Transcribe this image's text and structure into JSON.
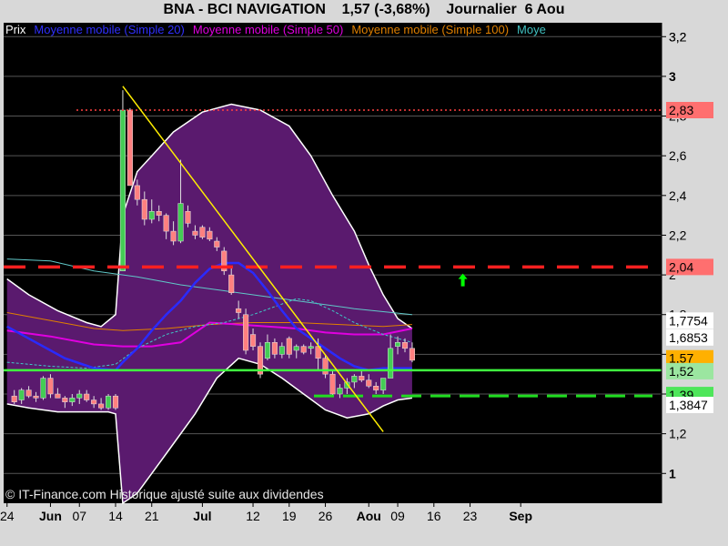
{
  "title": "BNA - BCI NAVIGATION    1,57 (-3,68%)    Journalier  6 Aou",
  "legend": [
    {
      "label": "Prix",
      "color": "#ffffff"
    },
    {
      "label": "Moyenne mobile (Simple 20)",
      "color": "#3030ff"
    },
    {
      "label": "Moyenne mobile (Simple 50)",
      "color": "#e000e0"
    },
    {
      "label": "Moyenne mobile (Simple 100)",
      "color": "#e08000"
    },
    {
      "label": "Moye",
      "color": "#40c0c0"
    }
  ],
  "copyright": "© IT-Finance.com Historique ajusté suite aux dividendes",
  "chart_data": {
    "type": "candlestick",
    "y_axis": {
      "range": [
        0.85,
        3.27
      ],
      "ticks": [
        "3,2",
        "3",
        "2,8",
        "2,6",
        "2,4",
        "2,2",
        "2",
        "1,8",
        "1,6",
        "1,4",
        "1,2",
        "1"
      ],
      "tick_values": [
        3.2,
        3.0,
        2.8,
        2.6,
        2.4,
        2.2,
        2.0,
        1.8,
        1.6,
        1.4,
        1.2,
        1.0
      ],
      "bold_ticks": [
        "3",
        "1"
      ]
    },
    "x_axis": {
      "labels": [
        {
          "text": "24",
          "i": -1,
          "bold": false
        },
        {
          "text": "Jun",
          "i": 5,
          "bold": true
        },
        {
          "text": "07",
          "i": 9,
          "bold": false
        },
        {
          "text": "14",
          "i": 14,
          "bold": false
        },
        {
          "text": "21",
          "i": 19,
          "bold": false
        },
        {
          "text": "Jul",
          "i": 26,
          "bold": true
        },
        {
          "text": "12",
          "i": 33,
          "bold": false
        },
        {
          "text": "19",
          "i": 38,
          "bold": false
        },
        {
          "text": "26",
          "i": 43,
          "bold": false
        },
        {
          "text": "Aou",
          "i": 49,
          "bold": true
        },
        {
          "text": "09",
          "i": 53,
          "bold": false
        },
        {
          "text": "16",
          "i": 58,
          "bold": false
        },
        {
          "text": "23",
          "i": 63,
          "bold": false
        },
        {
          "text": "Sep",
          "i": 70,
          "bold": true
        }
      ]
    },
    "candles": [
      {
        "o": 1.39,
        "h": 1.42,
        "l": 1.35,
        "c": 1.36
      },
      {
        "o": 1.37,
        "h": 1.43,
        "l": 1.35,
        "c": 1.42
      },
      {
        "o": 1.42,
        "h": 1.44,
        "l": 1.38,
        "c": 1.39
      },
      {
        "o": 1.39,
        "h": 1.41,
        "l": 1.36,
        "c": 1.38
      },
      {
        "o": 1.38,
        "h": 1.49,
        "l": 1.37,
        "c": 1.48
      },
      {
        "o": 1.48,
        "h": 1.5,
        "l": 1.38,
        "c": 1.4
      },
      {
        "o": 1.4,
        "h": 1.43,
        "l": 1.38,
        "c": 1.38
      },
      {
        "o": 1.38,
        "h": 1.39,
        "l": 1.33,
        "c": 1.36
      },
      {
        "o": 1.36,
        "h": 1.4,
        "l": 1.34,
        "c": 1.38
      },
      {
        "o": 1.38,
        "h": 1.42,
        "l": 1.35,
        "c": 1.4
      },
      {
        "o": 1.4,
        "h": 1.42,
        "l": 1.36,
        "c": 1.37
      },
      {
        "o": 1.37,
        "h": 1.39,
        "l": 1.33,
        "c": 1.35
      },
      {
        "o": 1.35,
        "h": 1.38,
        "l": 1.32,
        "c": 1.33
      },
      {
        "o": 1.33,
        "h": 1.4,
        "l": 1.32,
        "c": 1.39
      },
      {
        "o": 1.39,
        "h": 1.4,
        "l": 1.32,
        "c": 1.33
      },
      {
        "o": 2.02,
        "h": 2.93,
        "l": 2.02,
        "c": 2.83
      },
      {
        "o": 2.83,
        "h": 2.84,
        "l": 2.45,
        "c": 2.45
      },
      {
        "o": 2.45,
        "h": 2.48,
        "l": 2.35,
        "c": 2.38
      },
      {
        "o": 2.38,
        "h": 2.42,
        "l": 2.25,
        "c": 2.28
      },
      {
        "o": 2.28,
        "h": 2.38,
        "l": 2.26,
        "c": 2.32
      },
      {
        "o": 2.32,
        "h": 2.35,
        "l": 2.27,
        "c": 2.3
      },
      {
        "o": 2.3,
        "h": 2.31,
        "l": 2.18,
        "c": 2.22
      },
      {
        "o": 2.22,
        "h": 2.27,
        "l": 2.15,
        "c": 2.17
      },
      {
        "o": 2.17,
        "h": 2.58,
        "l": 2.16,
        "c": 2.36
      },
      {
        "o": 2.32,
        "h": 2.35,
        "l": 2.24,
        "c": 2.26
      },
      {
        "o": 2.22,
        "h": 2.25,
        "l": 2.18,
        "c": 2.2
      },
      {
        "o": 2.24,
        "h": 2.25,
        "l": 2.18,
        "c": 2.19
      },
      {
        "o": 2.22,
        "h": 2.24,
        "l": 2.17,
        "c": 2.18
      },
      {
        "o": 2.17,
        "h": 2.19,
        "l": 2.12,
        "c": 2.14
      },
      {
        "o": 2.12,
        "h": 2.14,
        "l": 2.0,
        "c": 2.02
      },
      {
        "o": 2.0,
        "h": 2.04,
        "l": 1.9,
        "c": 1.91
      },
      {
        "o": 1.83,
        "h": 1.87,
        "l": 1.78,
        "c": 1.81
      },
      {
        "o": 1.8,
        "h": 1.83,
        "l": 1.6,
        "c": 1.62
      },
      {
        "o": 1.7,
        "h": 1.73,
        "l": 1.62,
        "c": 1.64
      },
      {
        "o": 1.64,
        "h": 1.66,
        "l": 1.48,
        "c": 1.5
      },
      {
        "o": 1.58,
        "h": 1.7,
        "l": 1.57,
        "c": 1.66
      },
      {
        "o": 1.66,
        "h": 1.68,
        "l": 1.58,
        "c": 1.6
      },
      {
        "o": 1.6,
        "h": 1.66,
        "l": 1.58,
        "c": 1.64
      },
      {
        "o": 1.68,
        "h": 1.69,
        "l": 1.58,
        "c": 1.6
      },
      {
        "o": 1.62,
        "h": 1.65,
        "l": 1.58,
        "c": 1.64
      },
      {
        "o": 1.64,
        "h": 1.65,
        "l": 1.6,
        "c": 1.61
      },
      {
        "o": 1.63,
        "h": 1.66,
        "l": 1.6,
        "c": 1.64
      },
      {
        "o": 1.64,
        "h": 1.68,
        "l": 1.52,
        "c": 1.58
      },
      {
        "o": 1.58,
        "h": 1.6,
        "l": 1.48,
        "c": 1.5
      },
      {
        "o": 1.5,
        "h": 1.52,
        "l": 1.39,
        "c": 1.4
      },
      {
        "o": 1.4,
        "h": 1.45,
        "l": 1.38,
        "c": 1.43
      },
      {
        "o": 1.43,
        "h": 1.48,
        "l": 1.4,
        "c": 1.46
      },
      {
        "o": 1.46,
        "h": 1.5,
        "l": 1.43,
        "c": 1.49
      },
      {
        "o": 1.49,
        "h": 1.52,
        "l": 1.46,
        "c": 1.47
      },
      {
        "o": 1.47,
        "h": 1.5,
        "l": 1.43,
        "c": 1.44
      },
      {
        "o": 1.44,
        "h": 1.46,
        "l": 1.4,
        "c": 1.42
      },
      {
        "o": 1.42,
        "h": 1.48,
        "l": 1.4,
        "c": 1.48
      },
      {
        "o": 1.48,
        "h": 1.7,
        "l": 1.48,
        "c": 1.63
      },
      {
        "o": 1.64,
        "h": 1.69,
        "l": 1.6,
        "c": 1.66
      },
      {
        "o": 1.66,
        "h": 1.68,
        "l": 1.61,
        "c": 1.63
      },
      {
        "o": 1.63,
        "h": 1.66,
        "l": 1.56,
        "c": 1.57
      }
    ],
    "bollinger_upper": [
      [
        -1,
        1.98
      ],
      [
        2,
        1.9
      ],
      [
        6,
        1.82
      ],
      [
        10,
        1.76
      ],
      [
        12,
        1.74
      ],
      [
        14,
        1.8
      ],
      [
        15,
        2.3
      ],
      [
        17,
        2.52
      ],
      [
        19,
        2.6
      ],
      [
        22,
        2.72
      ],
      [
        26,
        2.82
      ],
      [
        30,
        2.86
      ],
      [
        34,
        2.83
      ],
      [
        38,
        2.75
      ],
      [
        41,
        2.6
      ],
      [
        44,
        2.4
      ],
      [
        47,
        2.22
      ],
      [
        49,
        2.05
      ],
      [
        51,
        1.9
      ],
      [
        53,
        1.78
      ],
      [
        55,
        1.73
      ]
    ],
    "bollinger_lower": [
      [
        -1,
        1.35
      ],
      [
        2,
        1.33
      ],
      [
        6,
        1.31
      ],
      [
        10,
        1.31
      ],
      [
        13,
        1.31
      ],
      [
        14,
        1.3
      ],
      [
        15,
        0.85
      ],
      [
        17,
        0.9
      ],
      [
        21,
        1.1
      ],
      [
        25,
        1.3
      ],
      [
        28,
        1.48
      ],
      [
        31,
        1.58
      ],
      [
        34,
        1.55
      ],
      [
        37,
        1.48
      ],
      [
        40,
        1.4
      ],
      [
        43,
        1.32
      ],
      [
        46,
        1.28
      ],
      [
        49,
        1.3
      ],
      [
        51,
        1.34
      ],
      [
        53,
        1.37
      ],
      [
        55,
        1.38
      ]
    ],
    "ma20": [
      [
        -1,
        1.74
      ],
      [
        3,
        1.66
      ],
      [
        7,
        1.58
      ],
      [
        11,
        1.53
      ],
      [
        14,
        1.52
      ],
      [
        15,
        1.56
      ],
      [
        17,
        1.63
      ],
      [
        19,
        1.72
      ],
      [
        21,
        1.8
      ],
      [
        23,
        1.87
      ],
      [
        25,
        1.96
      ],
      [
        27,
        2.03
      ],
      [
        29,
        2.06
      ],
      [
        31,
        2.06
      ],
      [
        33,
        2.01
      ],
      [
        35,
        1.92
      ],
      [
        37,
        1.82
      ],
      [
        39,
        1.73
      ],
      [
        41,
        1.68
      ],
      [
        43,
        1.63
      ],
      [
        45,
        1.58
      ],
      [
        47,
        1.54
      ],
      [
        49,
        1.52
      ],
      [
        51,
        1.53
      ],
      [
        53,
        1.53
      ],
      [
        55,
        1.53
      ]
    ],
    "ma50": [
      [
        -1,
        1.72
      ],
      [
        5,
        1.69
      ],
      [
        11,
        1.65
      ],
      [
        15,
        1.64
      ],
      [
        19,
        1.64
      ],
      [
        23,
        1.66
      ],
      [
        27,
        1.76
      ],
      [
        31,
        1.75
      ],
      [
        35,
        1.74
      ],
      [
        39,
        1.73
      ],
      [
        43,
        1.71
      ],
      [
        47,
        1.7
      ],
      [
        51,
        1.7
      ],
      [
        55,
        1.73
      ]
    ],
    "ma100": [
      [
        -1,
        1.81
      ],
      [
        5,
        1.77
      ],
      [
        11,
        1.73
      ],
      [
        15,
        1.72
      ],
      [
        21,
        1.73
      ],
      [
        27,
        1.75
      ],
      [
        33,
        1.76
      ],
      [
        39,
        1.76
      ],
      [
        45,
        1.75
      ],
      [
        51,
        1.74
      ],
      [
        55,
        1.75
      ]
    ],
    "ma_cyan_long": [
      [
        -1,
        2.08
      ],
      [
        5,
        2.07
      ],
      [
        11,
        2.02
      ],
      [
        17,
        1.99
      ],
      [
        23,
        1.95
      ],
      [
        29,
        1.92
      ],
      [
        35,
        1.89
      ],
      [
        41,
        1.86
      ],
      [
        47,
        1.83
      ],
      [
        55,
        1.8
      ]
    ],
    "ma_cyan_dashed": [
      [
        -1,
        1.56
      ],
      [
        5,
        1.54
      ],
      [
        10,
        1.53
      ],
      [
        14,
        1.55
      ],
      [
        17,
        1.63
      ],
      [
        21,
        1.7
      ],
      [
        25,
        1.74
      ],
      [
        29,
        1.76
      ],
      [
        33,
        1.8
      ],
      [
        36,
        1.84
      ],
      [
        39,
        1.88
      ],
      [
        41,
        1.87
      ],
      [
        44,
        1.82
      ],
      [
        47,
        1.76
      ],
      [
        51,
        1.7
      ],
      [
        55,
        1.66
      ]
    ],
    "trendline": {
      "from": [
        15,
        2.95
      ],
      "to": [
        51,
        1.21
      ]
    },
    "levels": [
      {
        "value": 2.83,
        "style": "dotted",
        "color": "#ff4040"
      },
      {
        "value": 2.04,
        "style": "dashed",
        "color": "#ff2020"
      },
      {
        "value": 1.52,
        "style": "solid",
        "color": "#40ff40"
      },
      {
        "value": 1.39,
        "style": "dashed",
        "color": "#20dd20"
      }
    ],
    "signal_arrow": {
      "i": 62,
      "value": 1.97,
      "color": "#00ff00"
    },
    "price_tags": [
      {
        "text": "3,2",
        "value": 3.2,
        "bg": null,
        "fg": "#000000"
      },
      {
        "text": "2,83",
        "value": 2.83,
        "bg": "#ff6f6f",
        "fg": "#000000"
      },
      {
        "text": "2,04",
        "value": 2.04,
        "bg": "#ff6f6f",
        "fg": "#000000"
      },
      {
        "text": "1,7754",
        "value": 1.77,
        "bg": "#ffffff",
        "fg": "#000000"
      },
      {
        "text": "1,6853",
        "value": 1.685,
        "bg": "#ffffff",
        "fg": "#000000"
      },
      {
        "text": "1,57",
        "value": 1.58,
        "bg": "#ffb000",
        "fg": "#000000"
      },
      {
        "text": "1,52",
        "value": 1.515,
        "bg": "#9be6a0",
        "fg": "#000000"
      },
      {
        "text": "1,39",
        "value": 1.395,
        "bg": "#4ee65a",
        "fg": "#000000"
      },
      {
        "text": "1,3847",
        "value": 1.345,
        "bg": "#ffffff",
        "fg": "#000000"
      }
    ]
  }
}
